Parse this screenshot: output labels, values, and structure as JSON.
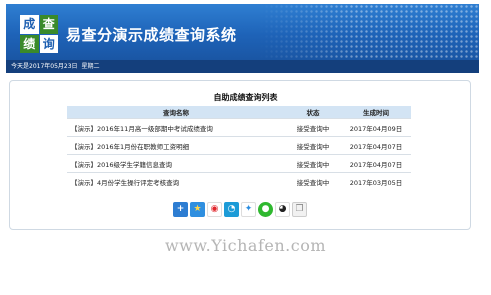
{
  "header": {
    "logo": [
      "成",
      "查",
      "绩",
      "询"
    ],
    "title": "易查分演示成绩查询系统"
  },
  "datebar": {
    "date": "今天是2017年05月23日",
    "weekday": "星期二"
  },
  "list": {
    "title": "自助成绩查询列表",
    "columns": [
      "查询名称",
      "状态",
      "生成时间"
    ],
    "rows": [
      {
        "name": "【演示】2016年11月高一级部期中考试成绩查询",
        "status": "接受查询中",
        "time": "2017年04月09日"
      },
      {
        "name": "【演示】2016年1月份在职教师工资明细",
        "status": "接受查询中",
        "time": "2017年04月07日"
      },
      {
        "name": "【演示】2016级学生学籍信息查询",
        "status": "接受查询中",
        "time": "2017年04月07日"
      },
      {
        "name": "【演示】4月份学生操行评定考核查询",
        "status": "接受查询中",
        "time": "2017年03月05日"
      }
    ]
  },
  "share_icons": [
    "plus-icon",
    "star-icon",
    "weibo-icon",
    "tencent-weibo-icon",
    "qzone-icon",
    "wechat-icon",
    "qq-icon",
    "copy-icon"
  ],
  "watermark": "www.Yichafen.com",
  "colors": {
    "banner": "#1e63b8",
    "datebar": "#143f7c",
    "table_header": "#d3e4f4",
    "logo_green": "#3a8a2a"
  }
}
